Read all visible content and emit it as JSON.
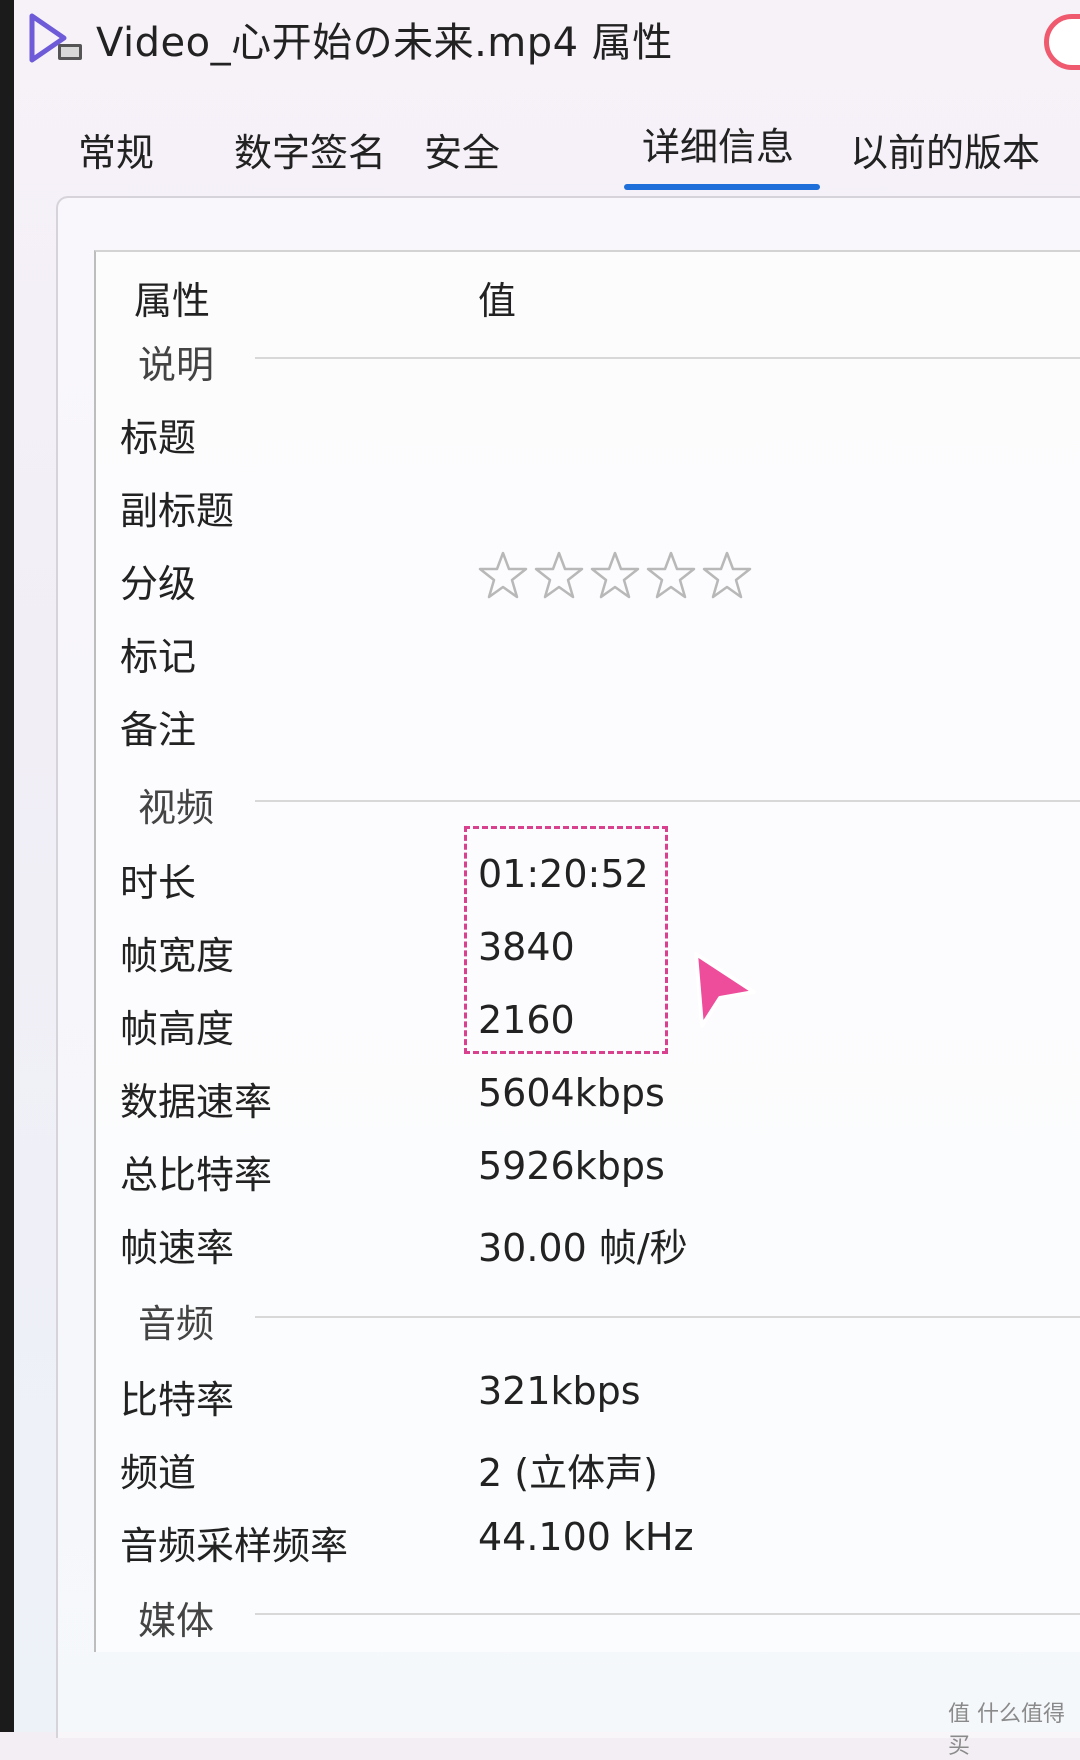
{
  "window": {
    "title": "Video_心开始の未来.mp4 属性"
  },
  "tabs": [
    {
      "label": "常规",
      "active": false
    },
    {
      "label": "数字签名",
      "active": false
    },
    {
      "label": "安全",
      "active": false
    },
    {
      "label": "详细信息",
      "active": true
    },
    {
      "label": "以前的版本",
      "active": false
    }
  ],
  "columns": {
    "property": "属性",
    "value": "值"
  },
  "groups": {
    "description": "说明",
    "video": "视频",
    "audio": "音频",
    "media": "媒体"
  },
  "description_rows": [
    {
      "name": "标题",
      "value": ""
    },
    {
      "name": "副标题",
      "value": ""
    },
    {
      "name": "分级",
      "value": ""
    },
    {
      "name": "标记",
      "value": ""
    },
    {
      "name": "备注",
      "value": ""
    }
  ],
  "rating": {
    "stars_filled": 0,
    "stars_total": 5
  },
  "video_rows": [
    {
      "name": "时长",
      "value": "01:20:52"
    },
    {
      "name": "帧宽度",
      "value": "3840"
    },
    {
      "name": "帧高度",
      "value": "2160"
    },
    {
      "name": "数据速率",
      "value": "5604kbps"
    },
    {
      "name": "总比特率",
      "value": "5926kbps"
    },
    {
      "name": "帧速率",
      "value": "30.00 帧/秒"
    }
  ],
  "audio_rows": [
    {
      "name": "比特率",
      "value": "321kbps"
    },
    {
      "name": "频道",
      "value": "2 (立体声)"
    },
    {
      "name": "音频采样频率",
      "value": "44.100 kHz"
    }
  ],
  "colors": {
    "tab_underline": "#1e6fd9",
    "highlight_border": "#d9408e",
    "cursor": "#ee4d9b",
    "close_border": "#ef5a6f"
  },
  "corner_watermark": "值 什么值得买"
}
